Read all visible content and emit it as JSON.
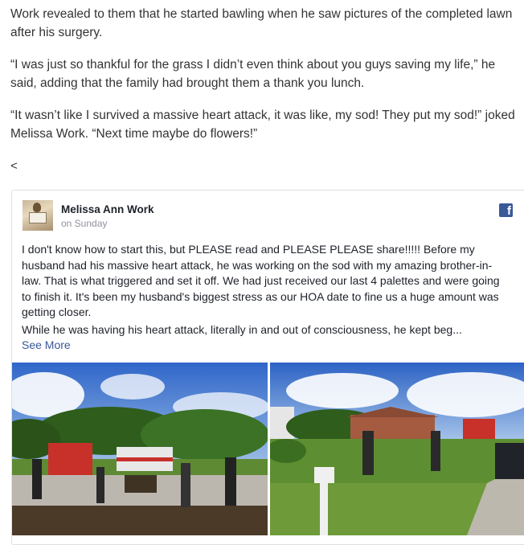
{
  "article": {
    "p1": "Work revealed to them that he started bawling when he saw pictures of the completed lawn after his surgery.",
    "p2": "“I was just so thankful for the grass I didn’t even think about you guys saving my life,” he said, adding that the family had brought them a thank you lunch.",
    "p3": "“It wasn’t like I survived a massive heart attack, it was like, my sod! They put my sod!” joked Melissa Work. “Next time maybe do flowers!”",
    "stray": "<"
  },
  "embed": {
    "author": "Melissa Ann Work",
    "time": "on Sunday",
    "fb_glyph": "f",
    "text1": "I don't know how to start this, but PLEASE read and PLEASE PLEASE share!!!!! Before my husband had his massive heart attack, he was working on the sod with my amazing brother-in-law. That is what triggered and set it off. We had just received our last 4 palettes and were going to finish it. It's been my husband's biggest stress as our HOA date to fine us a huge amount was getting closer.",
    "text2": "While he was having his heart attack, literally in and out of consciousness, he kept beg...",
    "see_more": "See More"
  },
  "colors": {
    "facebook_blue": "#3b5998",
    "link_blue": "#385898"
  }
}
